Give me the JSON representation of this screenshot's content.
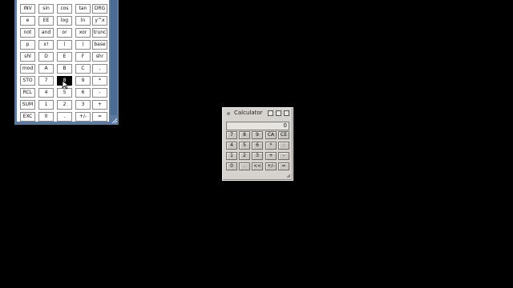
{
  "sci_calculator": {
    "rows": [
      [
        "INV",
        "sin",
        "cos",
        "tan",
        "DRG"
      ],
      [
        "e",
        "EE",
        "log",
        "ln",
        "y^x"
      ],
      [
        "not",
        "and",
        "or",
        "xor",
        "trunc"
      ],
      [
        "p",
        "x!",
        "(",
        ")",
        "base"
      ],
      [
        "shl",
        "D",
        "E",
        "F",
        "shr"
      ],
      [
        "mod",
        "A",
        "B",
        "C",
        ","
      ],
      [
        "STO",
        "7",
        "8",
        "9",
        "*"
      ],
      [
        "RCL",
        "4",
        "5",
        "6",
        "-"
      ],
      [
        "SUM",
        "1",
        "2",
        "3",
        "+"
      ],
      [
        "EXC",
        "0",
        ".",
        "+/-",
        "="
      ]
    ],
    "pressed_key": "8"
  },
  "calculator": {
    "title": "Calculator",
    "display": "0",
    "rows": [
      [
        "7",
        "8",
        "9",
        "CA",
        "CE"
      ],
      [
        "4",
        "5",
        "6",
        "*",
        ":"
      ],
      [
        "1",
        "2",
        "3",
        "+",
        "-"
      ],
      [
        "0",
        ".",
        "<<",
        "+/-",
        "="
      ]
    ]
  },
  "icons": {
    "window_menu": "window-menu-icon",
    "minimize": "minimize-icon",
    "maximize": "maximize-icon",
    "close": "close-icon",
    "resize": "resize-grip-icon",
    "cursor": "mouse-cursor-icon"
  }
}
